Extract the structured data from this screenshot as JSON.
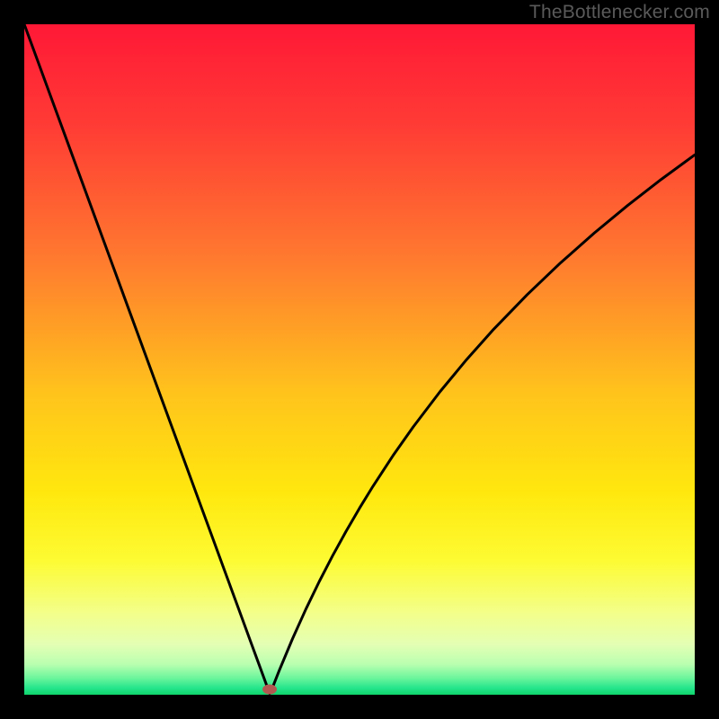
{
  "watermark": "TheBottlenecker.com",
  "colors": {
    "frame": "#000000",
    "curve": "#000000",
    "marker": "#b25a52",
    "watermark_text": "#5a5a5a"
  },
  "gradient_stops": [
    {
      "offset": 0.0,
      "color": "#ff1836"
    },
    {
      "offset": 0.15,
      "color": "#ff3b35"
    },
    {
      "offset": 0.35,
      "color": "#ff7a2f"
    },
    {
      "offset": 0.55,
      "color": "#ffc31c"
    },
    {
      "offset": 0.7,
      "color": "#ffe80e"
    },
    {
      "offset": 0.8,
      "color": "#fdfb33"
    },
    {
      "offset": 0.88,
      "color": "#f3ff8c"
    },
    {
      "offset": 0.925,
      "color": "#e4ffb4"
    },
    {
      "offset": 0.955,
      "color": "#b8ffb0"
    },
    {
      "offset": 0.975,
      "color": "#6cf59c"
    },
    {
      "offset": 0.99,
      "color": "#25e58c"
    },
    {
      "offset": 1.0,
      "color": "#0fd56c"
    }
  ],
  "chart_data": {
    "type": "line",
    "title": "",
    "xlabel": "",
    "ylabel": "",
    "xlim": [
      0,
      100
    ],
    "ylim": [
      0,
      100
    ],
    "grid": false,
    "x": [
      0,
      2,
      4,
      6,
      8,
      10,
      12,
      14,
      16,
      18,
      20,
      22,
      24,
      26,
      28,
      30,
      32,
      34,
      35,
      36,
      36.6,
      37,
      38,
      40,
      42,
      44,
      46,
      48,
      50,
      52,
      55,
      58,
      62,
      66,
      70,
      75,
      80,
      85,
      90,
      95,
      100
    ],
    "values": [
      100,
      94.55,
      89.09,
      83.64,
      78.18,
      72.73,
      67.27,
      61.82,
      56.36,
      50.91,
      45.45,
      40.0,
      34.55,
      29.09,
      23.64,
      18.18,
      12.73,
      7.27,
      4.55,
      1.82,
      0.18,
      1.0,
      3.54,
      8.33,
      12.76,
      16.89,
      20.75,
      24.38,
      27.82,
      31.08,
      35.67,
      39.93,
      45.19,
      50.02,
      54.5,
      59.66,
      64.43,
      68.85,
      72.98,
      76.86,
      80.52
    ],
    "marker": {
      "x": 36.6,
      "y": 0.0
    }
  }
}
